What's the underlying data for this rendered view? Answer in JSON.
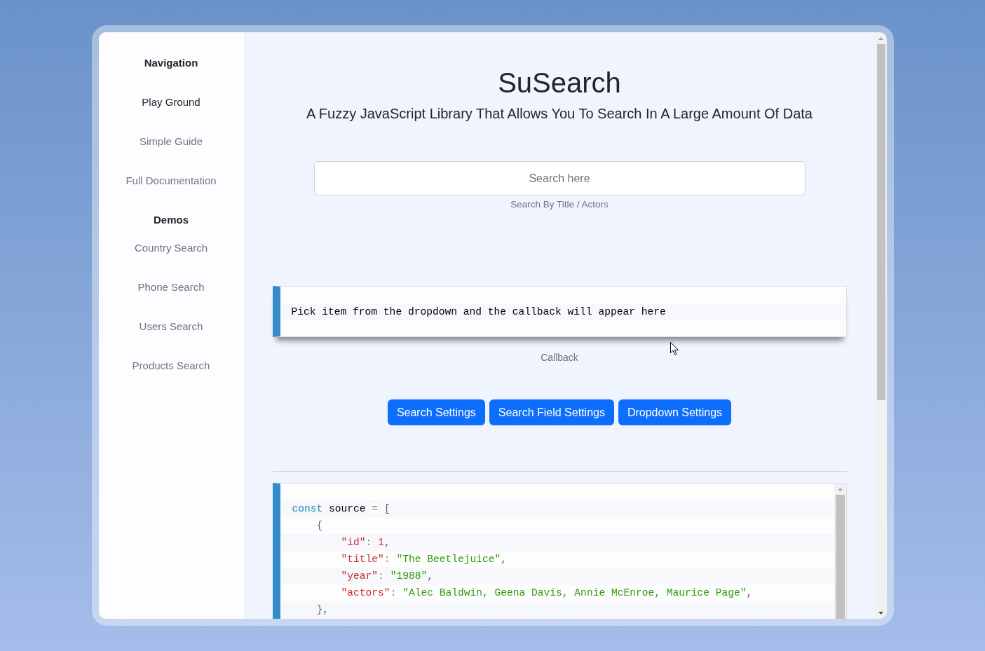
{
  "sidebar": {
    "sections": [
      {
        "heading": "Navigation",
        "items": [
          {
            "label": "Play Ground",
            "selected": true
          },
          {
            "label": "Simple Guide",
            "selected": false
          },
          {
            "label": "Full Documentation",
            "selected": false
          }
        ]
      },
      {
        "heading": "Demos",
        "items": [
          {
            "label": "Country Search",
            "selected": false
          },
          {
            "label": "Phone Search",
            "selected": false
          },
          {
            "label": "Users Search",
            "selected": false
          },
          {
            "label": "Products Search",
            "selected": false
          }
        ]
      }
    ]
  },
  "header": {
    "title": "SuSearch",
    "subtitle": "A Fuzzy JavaScript Library That Allows You To Search In A Large Amount Of Data"
  },
  "search": {
    "placeholder": "Search here",
    "hint": "Search By Title / Actors"
  },
  "callback": {
    "text": "Pick item from the dropdown and the callback will appear here",
    "caption": "Callback"
  },
  "settings_buttons": [
    "Search Settings",
    "Search Field Settings",
    "Dropdown Settings"
  ],
  "code": {
    "lines": [
      [
        {
          "kind": "keyword",
          "text": "const"
        },
        {
          "kind": "plain",
          "text": " source "
        },
        {
          "kind": "operator",
          "text": "="
        },
        {
          "kind": "punct",
          "text": " ["
        }
      ],
      [
        {
          "kind": "punct",
          "text": "    {"
        }
      ],
      [
        {
          "kind": "key",
          "text": "        \"id\""
        },
        {
          "kind": "operator",
          "text": ":"
        },
        {
          "kind": "number",
          "text": " 1"
        },
        {
          "kind": "punct",
          "text": ","
        }
      ],
      [
        {
          "kind": "key",
          "text": "        \"title\""
        },
        {
          "kind": "operator",
          "text": ":"
        },
        {
          "kind": "string",
          "text": " \"The Beetlejuice\""
        },
        {
          "kind": "punct",
          "text": ","
        }
      ],
      [
        {
          "kind": "key",
          "text": "        \"year\""
        },
        {
          "kind": "operator",
          "text": ":"
        },
        {
          "kind": "string",
          "text": " \"1988\""
        },
        {
          "kind": "punct",
          "text": ","
        }
      ],
      [
        {
          "kind": "key",
          "text": "        \"actors\""
        },
        {
          "kind": "operator",
          "text": ":"
        },
        {
          "kind": "string",
          "text": " \"Alec Baldwin, Geena Davis, Annie McEnroe, Maurice Page\""
        },
        {
          "kind": "punct",
          "text": ","
        }
      ],
      [
        {
          "kind": "punct",
          "text": "    },"
        }
      ]
    ]
  }
}
